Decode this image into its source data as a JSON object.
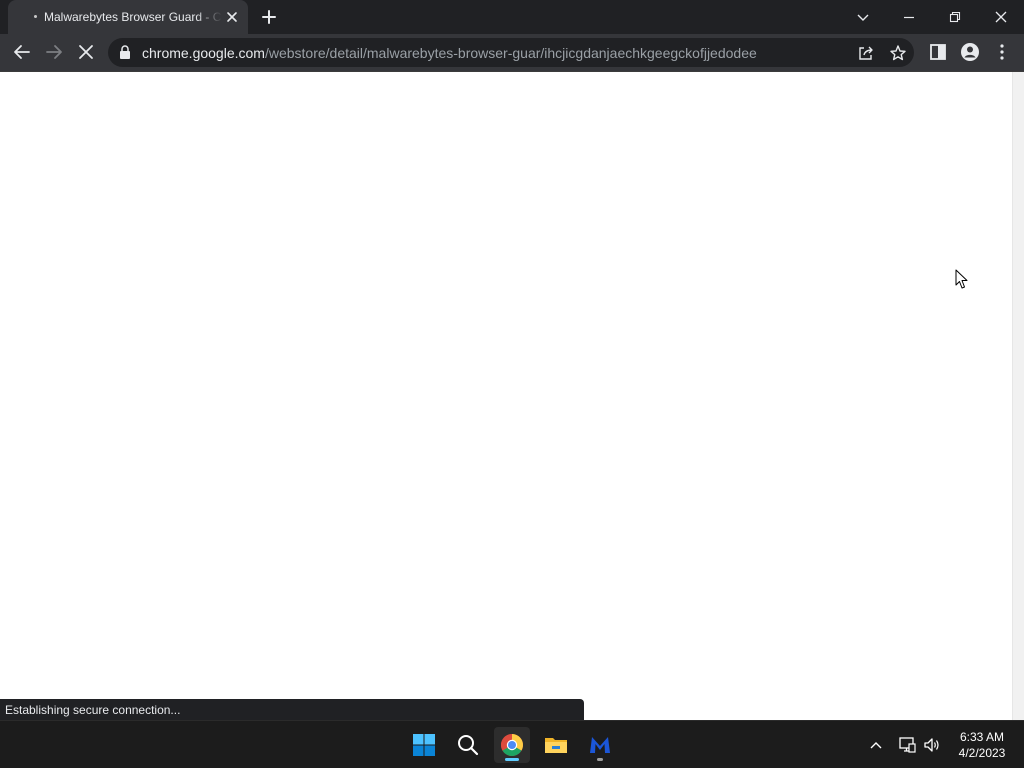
{
  "browser": {
    "tab": {
      "title": "Malwarebytes Browser Guard - Chrome Web Store",
      "state": "loading"
    },
    "omnibox": {
      "host": "chrome.google.com",
      "path": "/webstore/detail/malwarebytes-browser-guar/ihcjicgdanjaechkgeegckofjjedodee"
    },
    "status_text": "Establishing secure connection..."
  },
  "taskbar": {
    "apps": [
      {
        "name": "Start",
        "icon": "windows-logo-icon"
      },
      {
        "name": "Search",
        "icon": "search-icon"
      },
      {
        "name": "Google Chrome",
        "icon": "chrome-icon",
        "active": true
      },
      {
        "name": "File Explorer",
        "icon": "folder-icon"
      },
      {
        "name": "Malwarebytes",
        "icon": "malwarebytes-icon",
        "running": true
      }
    ],
    "clock": {
      "time": "6:33 AM",
      "date": "4/2/2023"
    }
  },
  "colors": {
    "titlebar_bg": "#202124",
    "toolbar_bg": "#35363a",
    "taskbar_bg": "#1c1c1c",
    "accent": "#60cdff"
  }
}
